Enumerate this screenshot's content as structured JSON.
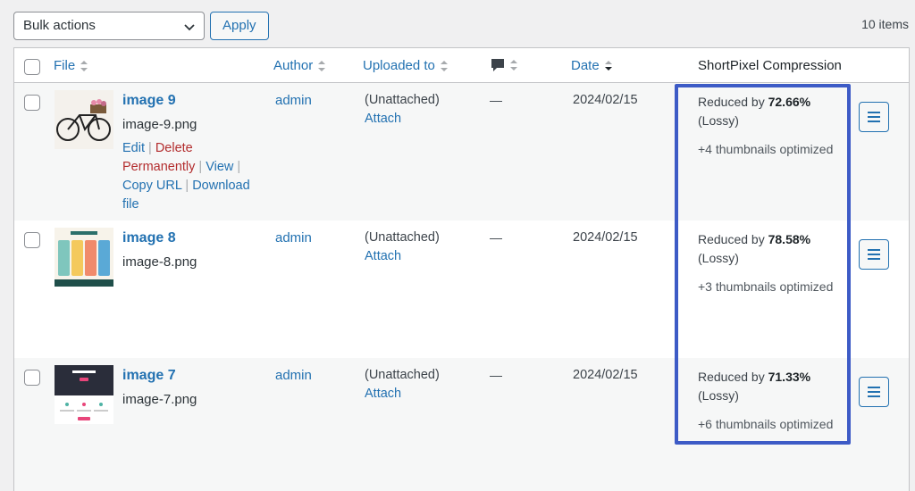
{
  "toolbar": {
    "bulk_actions_label": "Bulk actions",
    "apply_label": "Apply",
    "items_count": "10 items"
  },
  "columns": {
    "file": "File",
    "author": "Author",
    "uploaded_to": "Uploaded to",
    "date": "Date",
    "shortpixel": "ShortPixel Compression"
  },
  "rows": [
    {
      "title": "image 9",
      "filename": "image-9.png",
      "actions": {
        "edit": "Edit",
        "delete": "Delete Permanently",
        "view": "View",
        "copy_url": "Copy URL",
        "download": "Download file"
      },
      "author": "admin",
      "uploaded_to": "(Unattached)",
      "attach": "Attach",
      "comments": "—",
      "date": "2024/02/15",
      "reduced_prefix": "Reduced by",
      "reduced_pct": "72.66%",
      "mode": "(Lossy)",
      "thumbnails": "+4 thumbnails optimized"
    },
    {
      "title": "image 8",
      "filename": "image-8.png",
      "author": "admin",
      "uploaded_to": "(Unattached)",
      "attach": "Attach",
      "comments": "—",
      "date": "2024/02/15",
      "reduced_prefix": "Reduced by",
      "reduced_pct": "78.58%",
      "mode": "(Lossy)",
      "thumbnails": "+3 thumbnails optimized"
    },
    {
      "title": "image 7",
      "filename": "image-7.png",
      "author": "admin",
      "uploaded_to": "(Unattached)",
      "attach": "Attach",
      "comments": "—",
      "date": "2024/02/15",
      "reduced_prefix": "Reduced by",
      "reduced_pct": "71.33%",
      "mode": "(Lossy)",
      "thumbnails": "+6 thumbnails optimized"
    }
  ],
  "colors": {
    "link": "#2271b1",
    "delete": "#b32d2e",
    "highlight": "#3d5bc6"
  }
}
